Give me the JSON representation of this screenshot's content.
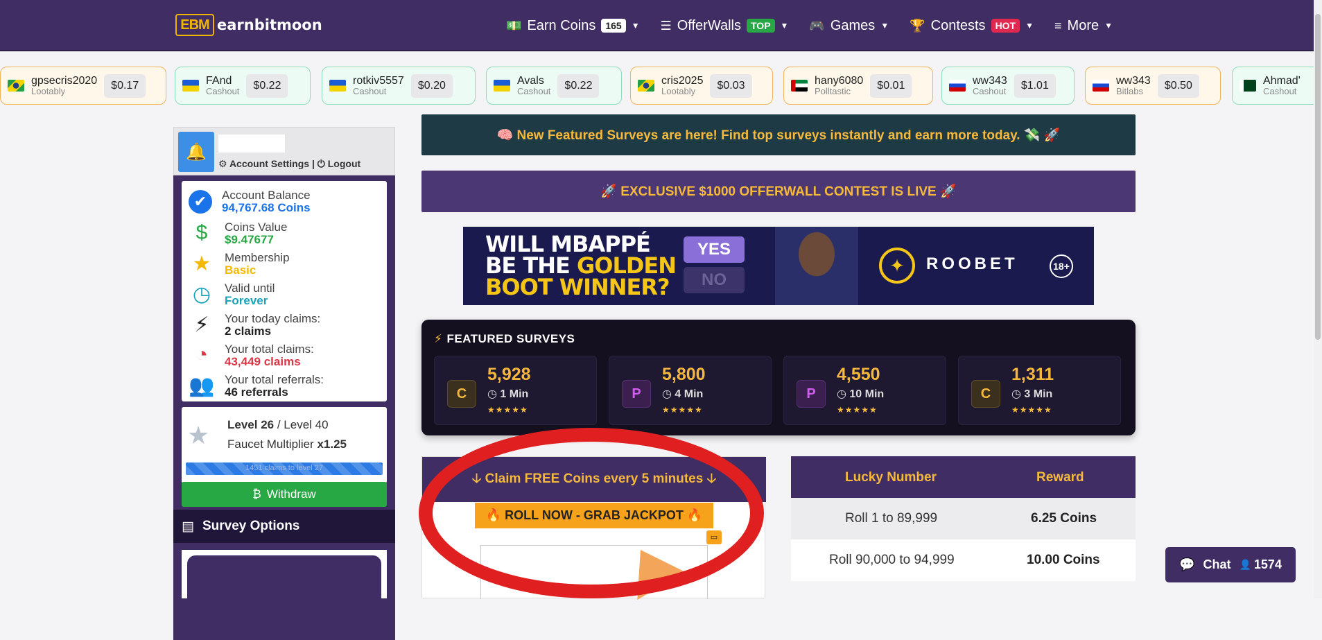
{
  "nav": {
    "logo_mark": "EBM",
    "logo_text": "earnbitmoon",
    "items": [
      {
        "label": "Earn Coins",
        "badge": "165",
        "badge_color": "white",
        "icon": "money-icon"
      },
      {
        "label": "OfferWalls",
        "badge": "TOP",
        "badge_color": "green",
        "icon": "list-icon"
      },
      {
        "label": "Games",
        "badge": "",
        "badge_color": "",
        "icon": "gamepad-icon"
      },
      {
        "label": "Contests",
        "badge": "HOT",
        "badge_color": "red",
        "icon": "trophy-icon"
      },
      {
        "label": "More",
        "badge": "",
        "badge_color": "",
        "icon": "menu-icon"
      }
    ]
  },
  "ticker": [
    {
      "user": "gpsecris2020",
      "source": "Lootably",
      "amount": "$0.17",
      "flag": "brazil",
      "style": "orange"
    },
    {
      "user": "FAnd",
      "source": "Cashout",
      "amount": "$0.22",
      "flag": "ukraine",
      "style": "green"
    },
    {
      "user": "rotkiv5557",
      "source": "Cashout",
      "amount": "$0.20",
      "flag": "ukraine",
      "style": "green"
    },
    {
      "user": "Avals",
      "source": "Cashout",
      "amount": "$0.22",
      "flag": "ukraine",
      "style": "green"
    },
    {
      "user": "cris2025",
      "source": "Lootably",
      "amount": "$0.03",
      "flag": "brazil",
      "style": "orange"
    },
    {
      "user": "hany6080",
      "source": "Polltastic",
      "amount": "$0.01",
      "flag": "uae",
      "style": "orange"
    },
    {
      "user": "ww343",
      "source": "Cashout",
      "amount": "$1.01",
      "flag": "russia",
      "style": "green"
    },
    {
      "user": "ww343",
      "source": "Bitlabs",
      "amount": "$0.50",
      "flag": "russia",
      "style": "orange"
    },
    {
      "user": "Ahmad'",
      "source": "Cashout",
      "amount": "",
      "flag": "pakistan",
      "style": "green"
    }
  ],
  "sidebar": {
    "account_settings": "Account Settings",
    "logout": "Logout",
    "stats": [
      {
        "label": "Account Balance",
        "value": "94,767.68 Coins",
        "color": "#1a73e8",
        "icon": "check-circle-icon"
      },
      {
        "label": "Coins Value",
        "value": "$9.47677",
        "color": "#28a745",
        "icon": "dollar-icon"
      },
      {
        "label": "Membership",
        "value": "Basic",
        "color": "#f5b800",
        "icon": "star-icon"
      },
      {
        "label": "Valid until",
        "value": "Forever",
        "color": "#17a2b8",
        "icon": "clock-icon"
      },
      {
        "label": "Your today claims:",
        "value": "2 claims",
        "color": "#222222",
        "icon": "bolt-icon"
      },
      {
        "label": "Your total claims:",
        "value": "43,449 claims",
        "color": "#dc3545",
        "icon": "pie-chart-icon"
      },
      {
        "label": "Your total referrals:",
        "value": "46 referrals",
        "color": "#222222",
        "icon": "users-icon"
      }
    ],
    "level": "Level 26",
    "level_next": "/ Level 40",
    "multiplier_label": "Faucet Multiplier",
    "multiplier_value": "x1.25",
    "progress_text": "1451 claims to level 27",
    "progress_fraction": 1.0,
    "withdraw": "Withdraw",
    "survey_options": "Survey Options"
  },
  "main": {
    "banner_featured": "🧠 New Featured Surveys are here! Find top surveys instantly and earn more today. 💸 🚀",
    "banner_contest": "🚀  EXCLUSIVE $1000 OFFERWALL CONTEST IS LIVE  🚀",
    "ad": {
      "line1": "WILL MBAPPÉ",
      "line2a": "BE THE ",
      "line2b": "GOLDEN",
      "line3": "BOOT WINNER?",
      "yes": "YES",
      "no": "NO",
      "brand": "ROOBET",
      "age": "18+"
    },
    "featured_title": "FEATURED SURVEYS",
    "featured": [
      {
        "badge": "C",
        "type": "c",
        "amount": "5,928",
        "time": "1 Min",
        "stars": "★★★★★"
      },
      {
        "badge": "P",
        "type": "p",
        "amount": "5,800",
        "time": "4 Min",
        "stars": "★★★★★"
      },
      {
        "badge": "P",
        "type": "p",
        "amount": "4,550",
        "time": "10 Min",
        "stars": "★★★★★"
      },
      {
        "badge": "C",
        "type": "c",
        "amount": "1,311",
        "time": "3 Min",
        "stars": "★★★★★"
      }
    ],
    "claim_header": "🡣 Claim FREE Coins every 5 minutes 🡣",
    "roll_button": "🔥 ROLL NOW - GRAB JACKPOT 🔥",
    "lucky_header": {
      "col1": "Lucky Number",
      "col2": "Reward"
    },
    "lucky_rows": [
      {
        "range": "Roll 1 to 89,999",
        "reward": "6.25 Coins"
      },
      {
        "range": "Roll 90,000 to 94,999",
        "reward": "10.00 Coins"
      }
    ]
  },
  "chat": {
    "label": "Chat",
    "count": "1574"
  }
}
